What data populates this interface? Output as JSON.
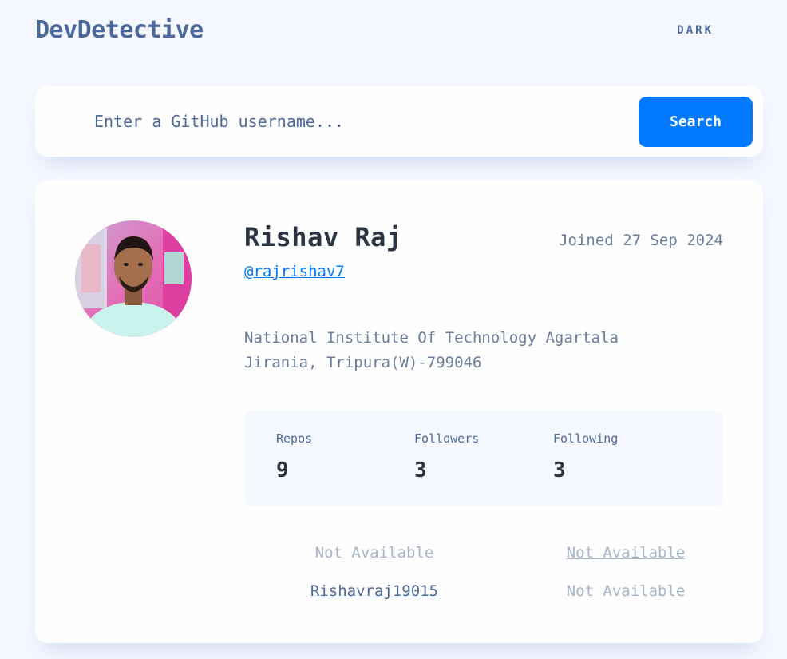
{
  "header": {
    "logo": "DevDetective",
    "theme_toggle": "DARK"
  },
  "search": {
    "placeholder": "Enter a GitHub username...",
    "button_label": "Search"
  },
  "profile": {
    "name": "Rishav Raj",
    "joined": "Joined 27 Sep 2024",
    "username": "@rajrishav7",
    "bio_lines": [
      "National Institute Of Technology Agartala",
      "Jirania, Tripura(W)-799046"
    ],
    "stats": [
      {
        "label": "Repos",
        "value": "9"
      },
      {
        "label": "Followers",
        "value": "3"
      },
      {
        "label": "Following",
        "value": "3"
      }
    ],
    "links": {
      "location": "Not Available",
      "website": "Not Available",
      "twitter": "Rishavraj19015",
      "company": "Not Available"
    }
  },
  "colors": {
    "accent": "#0079ff",
    "background": "#f5f8ff",
    "card": "#fefefe",
    "text_dark": "#2b3442",
    "text_muted": "#697c9a"
  }
}
